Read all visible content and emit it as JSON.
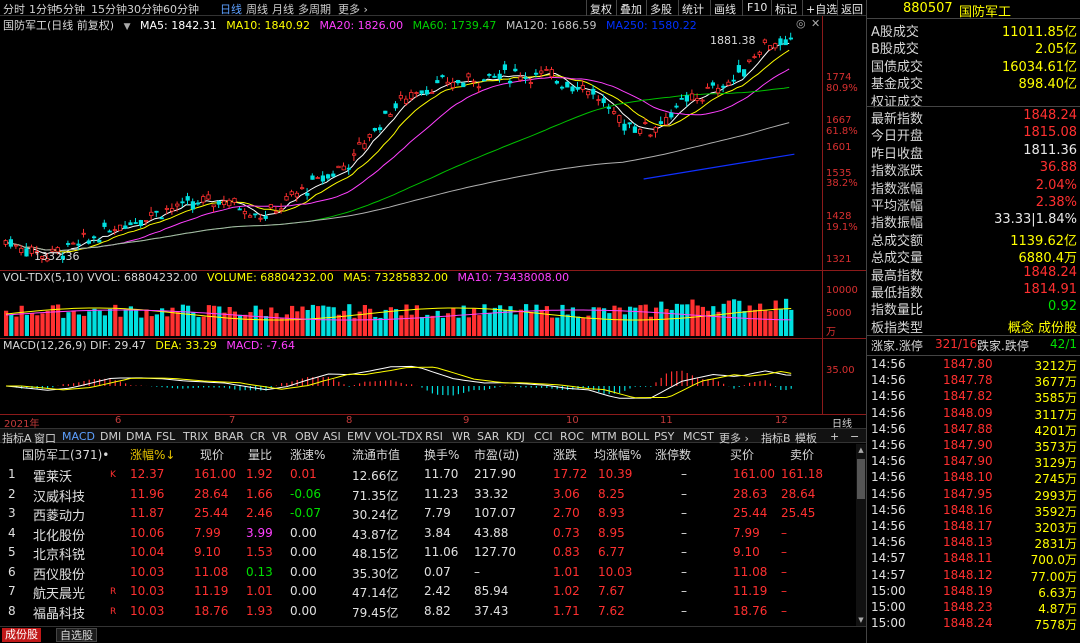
{
  "toolbar": {
    "periods": [
      "分时",
      "1分钟",
      "5分钟",
      "15分钟",
      "30分钟",
      "60分钟",
      "日线",
      "周线",
      "月线",
      "多周期",
      "更多 ›"
    ],
    "active_period": "日线",
    "actions": [
      "复权",
      "叠加",
      "多股",
      "统计",
      "画线",
      "F10",
      "标记",
      "+自选",
      "返回"
    ]
  },
  "main": {
    "stock_name": "国防军工(日线 前复权)",
    "ma": [
      {
        "label": "MA5: 1842.31",
        "color": "#ffffff"
      },
      {
        "label": "MA10: 1840.92",
        "color": "#ffff00"
      },
      {
        "label": "MA20: 1826.00",
        "color": "#ff40ff"
      },
      {
        "label": "MA60: 1739.47",
        "color": "#00d000"
      },
      {
        "label": "MA120: 1686.59",
        "color": "#c0c0c0"
      },
      {
        "label": "MA250: 1580.22",
        "color": "#0030ff"
      }
    ],
    "y_labels": [
      "1774",
      "80.9%",
      "1667",
      "61.8%",
      "1601",
      "1535",
      "38.2%",
      "1428",
      "19.1%",
      "1321"
    ],
    "high_label": "1881.38",
    "low_label": "1332.36"
  },
  "vol": {
    "legend": [
      {
        "label": "VOL-TDX(5,10) VVOL: 68804232.00",
        "color": "#d8d8d8"
      },
      {
        "label": "VOLUME: 68804232.00",
        "color": "#ffff00"
      },
      {
        "label": "MA5: 73285832.00",
        "color": "#ffff00"
      },
      {
        "label": "MA10: 73438008.00",
        "color": "#ff40ff"
      }
    ],
    "y_labels": [
      "10000",
      "5000",
      "万"
    ]
  },
  "macd": {
    "legend": [
      {
        "label": "MACD(12,26,9) DIF: 29.47",
        "color": "#d8d8d8"
      },
      {
        "label": "DEA: 33.29",
        "color": "#ffff00"
      },
      {
        "label": "MACD: -7.64",
        "color": "#ff40ff"
      }
    ],
    "y_labels": [
      "35.00"
    ]
  },
  "xaxis": {
    "labels": [
      "2021年",
      "6",
      "7",
      "8",
      "9",
      "10",
      "11",
      "12"
    ],
    "period": "日线"
  },
  "indicator_tabs": [
    "指标A",
    "窗口",
    "MACD",
    "DMI",
    "DMA",
    "FSL",
    "TRIX",
    "BRAR",
    "CR",
    "VR",
    "OBV",
    "ASI",
    "EMV",
    "VOL-TDX",
    "RSI",
    "WR",
    "SAR",
    "KDJ",
    "CCI",
    "ROC",
    "MTM",
    "BOLL",
    "PSY",
    "MCST",
    "更多 ›",
    "指标B",
    "模板",
    "+",
    "−"
  ],
  "active_indicator_tab": "MACD",
  "table": {
    "headers": [
      "国防军工(371)•",
      "涨幅%↓",
      "现价",
      "量比",
      "涨速%",
      "流通市值",
      "换手%",
      "市盈(动)",
      "涨跌",
      "均涨幅%",
      "涨停数",
      "买价",
      "卖价"
    ],
    "rows": [
      {
        "idx": "1",
        "name": "霍莱沃",
        "flag": "K",
        "chg": "12.37",
        "price": "161.00",
        "vr": "1.92",
        "spd": "0.01",
        "mcap": "12.66亿",
        "turn": "11.70",
        "pe": "217.90",
        "diff": "17.72",
        "avg": "10.39",
        "lim": "–",
        "bid": "161.00",
        "ask": "161.18"
      },
      {
        "idx": "2",
        "name": "汉威科技",
        "flag": "",
        "chg": "11.96",
        "price": "28.64",
        "vr": "1.66",
        "spd": "-0.06",
        "mcap": "71.35亿",
        "turn": "11.23",
        "pe": "33.32",
        "diff": "3.06",
        "avg": "8.25",
        "lim": "–",
        "bid": "28.63",
        "ask": "28.64"
      },
      {
        "idx": "3",
        "name": "西菱动力",
        "flag": "",
        "chg": "11.87",
        "price": "25.44",
        "vr": "2.46",
        "spd": "-0.07",
        "mcap": "30.24亿",
        "turn": "7.79",
        "pe": "107.07",
        "diff": "2.70",
        "avg": "8.93",
        "lim": "–",
        "bid": "25.44",
        "ask": "25.45"
      },
      {
        "idx": "4",
        "name": "北化股份",
        "flag": "",
        "chg": "10.06",
        "price": "7.99",
        "vr": "3.99",
        "spd": "0.00",
        "mcap": "43.87亿",
        "turn": "3.84",
        "pe": "43.88",
        "diff": "0.73",
        "avg": "8.95",
        "lim": "–",
        "bid": "7.99",
        "ask": "–"
      },
      {
        "idx": "5",
        "name": "北京科锐",
        "flag": "",
        "chg": "10.04",
        "price": "9.10",
        "vr": "1.53",
        "spd": "0.00",
        "mcap": "48.15亿",
        "turn": "11.06",
        "pe": "127.70",
        "diff": "0.83",
        "avg": "6.77",
        "lim": "–",
        "bid": "9.10",
        "ask": "–"
      },
      {
        "idx": "6",
        "name": "西仪股份",
        "flag": "",
        "chg": "10.03",
        "price": "11.08",
        "vr": "0.13",
        "spd": "0.00",
        "mcap": "35.30亿",
        "turn": "0.07",
        "pe": "–",
        "diff": "1.01",
        "avg": "10.03",
        "lim": "–",
        "bid": "11.08",
        "ask": "–"
      },
      {
        "idx": "7",
        "name": "航天晨光",
        "flag": "R",
        "chg": "10.03",
        "price": "11.19",
        "vr": "1.01",
        "spd": "0.00",
        "mcap": "47.14亿",
        "turn": "2.42",
        "pe": "85.94",
        "diff": "1.02",
        "avg": "7.67",
        "lim": "–",
        "bid": "11.19",
        "ask": "–"
      },
      {
        "idx": "8",
        "name": "福晶科技",
        "flag": "R",
        "chg": "10.03",
        "price": "18.76",
        "vr": "1.93",
        "spd": "0.00",
        "mcap": "79.45亿",
        "turn": "8.82",
        "pe": "37.43",
        "diff": "1.71",
        "avg": "7.62",
        "lim": "–",
        "bid": "18.76",
        "ask": "–"
      }
    ]
  },
  "bottom_tabs": [
    "成份股",
    "自选股"
  ],
  "right": {
    "code": "880507",
    "name": "国防军工",
    "stats": [
      {
        "k": "A股成交",
        "v": "11011.85亿",
        "c": "#ffff00"
      },
      {
        "k": "B股成交",
        "v": "2.05亿",
        "c": "#ffff00"
      },
      {
        "k": "国债成交",
        "v": "16034.61亿",
        "c": "#ffff00"
      },
      {
        "k": "基金成交",
        "v": "898.40亿",
        "c": "#ffff00"
      },
      {
        "k": "权证成交",
        "v": "",
        "c": "#ffff00"
      },
      {
        "k": "最新指数",
        "v": "1848.24",
        "c": "#ff3030"
      },
      {
        "k": "今日开盘",
        "v": "1815.08",
        "c": "#ff3030"
      },
      {
        "k": "昨日收盘",
        "v": "1811.36",
        "c": "#e8e8e8"
      },
      {
        "k": "指数涨跌",
        "v": "36.88",
        "c": "#ff3030"
      },
      {
        "k": "指数涨幅",
        "v": "2.04%",
        "c": "#ff3030"
      },
      {
        "k": "平均涨幅",
        "v": "2.38%",
        "c": "#ff3030"
      },
      {
        "k": "指数振幅",
        "v": "33.33|1.84%",
        "c": "#e8e8e8"
      },
      {
        "k": "总成交额",
        "v": "1139.62亿",
        "c": "#ffff00"
      },
      {
        "k": "总成交量",
        "v": "6880.4万",
        "c": "#ffff00"
      },
      {
        "k": "最高指数",
        "v": "1848.24",
        "c": "#ff3030"
      },
      {
        "k": "最低指数",
        "v": "1814.91",
        "c": "#ff3030"
      },
      {
        "k": "指数量比",
        "v": "0.92",
        "c": "#00e000"
      }
    ],
    "type_label": "板指类型",
    "type_value": "概念 成份股",
    "updown": {
      "k1": "涨家.涨停",
      "v1": "321/16",
      "k2": "跌家.跌停",
      "v2": "42/1"
    },
    "ticks": [
      {
        "t": "14:56",
        "p": "1847.80",
        "v": "3212万"
      },
      {
        "t": "14:56",
        "p": "1847.78",
        "v": "3677万"
      },
      {
        "t": "14:56",
        "p": "1847.82",
        "v": "3585万"
      },
      {
        "t": "14:56",
        "p": "1848.09",
        "v": "3117万"
      },
      {
        "t": "14:56",
        "p": "1847.88",
        "v": "4201万"
      },
      {
        "t": "14:56",
        "p": "1847.90",
        "v": "3573万"
      },
      {
        "t": "14:56",
        "p": "1847.90",
        "v": "3129万"
      },
      {
        "t": "14:56",
        "p": "1848.10",
        "v": "2745万"
      },
      {
        "t": "14:56",
        "p": "1847.95",
        "v": "2993万"
      },
      {
        "t": "14:56",
        "p": "1848.16",
        "v": "3592万"
      },
      {
        "t": "14:56",
        "p": "1848.17",
        "v": "3203万"
      },
      {
        "t": "14:56",
        "p": "1848.13",
        "v": "2831万"
      },
      {
        "t": "14:57",
        "p": "1848.11",
        "v": "700.0万"
      },
      {
        "t": "14:57",
        "p": "1848.12",
        "v": "77.00万"
      },
      {
        "t": "15:00",
        "p": "1848.19",
        "v": "6.63万"
      },
      {
        "t": "15:00",
        "p": "1848.23",
        "v": "4.87万"
      },
      {
        "t": "15:00",
        "p": "1848.24",
        "v": "7578万"
      }
    ]
  }
}
